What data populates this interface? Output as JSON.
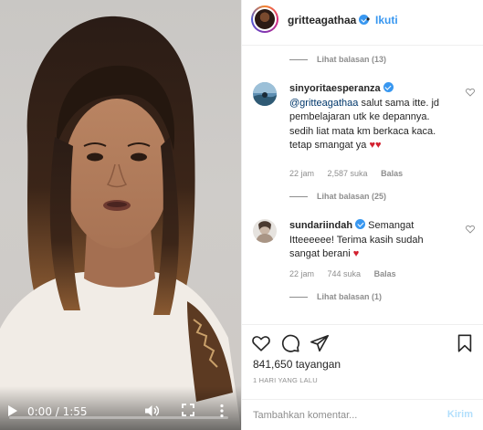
{
  "video": {
    "time": "0:00 / 1:55",
    "controls": [
      "play-icon",
      "volume-icon",
      "fullscreen-icon",
      "more-vert-icon"
    ]
  },
  "header": {
    "username": "gritteagathaa",
    "separator": "•",
    "follow_label": "Ikuti"
  },
  "comments": {
    "replies_1": "Lihat balasan (13)",
    "items": [
      {
        "username": "sinyoritaesperanza",
        "mention": "@gritteagathaa",
        "text": " salut sama itte. jd pembelajaran utk ke depannya. sedih liat mata km berkaca kaca. tetap smangat ya",
        "emoji": "♥♥",
        "time": "22 jam",
        "likes": "2,587 suka",
        "reply": "Balas",
        "replies": "Lihat balasan (25)"
      },
      {
        "username": "sundariindah",
        "mention": "",
        "text": "Semangat Itteeeeee! Terima kasih sudah sangat berani",
        "emoji": "♥",
        "time": "22 jam",
        "likes": "744 suka",
        "reply": "Balas",
        "replies": "Lihat balasan (1)"
      }
    ]
  },
  "actions": {
    "views": "841,650 tayangan",
    "date": "1 HARI YANG LALU"
  },
  "add_comment": {
    "placeholder": "Tambahkan komentar...",
    "post_label": "Kirim"
  },
  "colors": {
    "link_blue": "#3897f0",
    "muted": "#8e8e8e",
    "heart_red": "#d3202f",
    "post_disabled": "#b2dffc"
  }
}
